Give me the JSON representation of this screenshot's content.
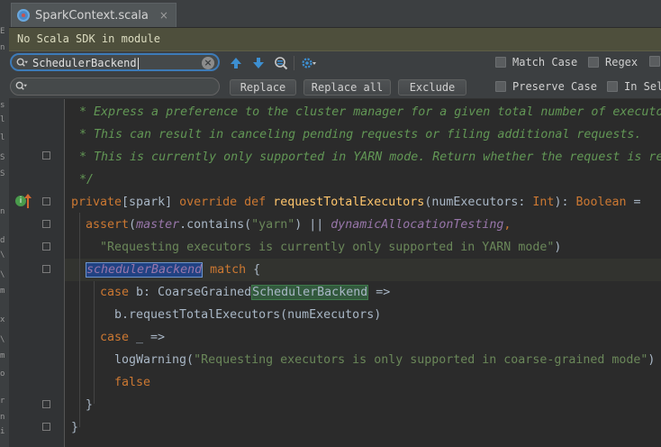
{
  "tab": {
    "title": "SparkContext.scala",
    "close": "×",
    "icon": "scala-file-icon"
  },
  "banner": {
    "text": "No Scala SDK in module"
  },
  "find": {
    "search_value": "SchedulerBackend",
    "replace_value": "",
    "buttons": {
      "replace": "Replace",
      "replace_all": "Replace all",
      "exclude": "Exclude"
    },
    "options": {
      "match_case": "Match Case",
      "regex": "Regex",
      "preserve_case": "Preserve Case",
      "in_selection": "In Sel"
    }
  },
  "code": {
    "line1": " * Express a preference to the cluster manager for a given total number of executo",
    "line2": " * This can result in canceling pending requests or filing additional requests.",
    "line3": " * This is currently only supported in YARN mode. Return whether the request is re",
    "line4": " */",
    "l5_private": "private",
    "l5_spark": "[spark] ",
    "l5_override": "override",
    "l5_def": "def",
    "l5_name": "requestTotalExecutors",
    "l5_param": "(numExecutors: ",
    "l5_int": "Int",
    "l5_close": "): ",
    "l5_bool": "Boolean",
    "l5_eq": " =",
    "l6_assert": "assert",
    "l6_open": "(",
    "l6_master": "master",
    "l6_contains": ".contains(",
    "l6_yarn": "\"yarn\"",
    "l6_or": ") || ",
    "l6_dyn": "dynamicAllocationTesting",
    "l6_comma": ",",
    "l7_str": "\"Requesting executors is currently only supported in YARN mode\"",
    "l7_close": ")",
    "l8_sched": "schedulerBackend",
    "l8_match": "match",
    "l8_brace": " {",
    "l9_case": "case",
    "l9_b": " b: CoarseGrained",
    "l9_hit": "SchedulerBackend",
    "l9_arrow": " =>",
    "l10": "b.requestTotalExecutors(numExecutors)",
    "l11_case": "case",
    "l11_rest": " _ =>",
    "l12_log": "logWarning(",
    "l12_str": "\"Requesting executors is only supported in coarse-grained mode\"",
    "l12_close": ")",
    "l13_false": "false",
    "l14": "}",
    "l15": "}"
  },
  "left_strip": [
    "E",
    "n",
    "s",
    "l",
    "l",
    "S",
    "S",
    "n",
    "d",
    "\\",
    "\\",
    "m",
    "x",
    "\\",
    "m",
    "o",
    "r",
    "n",
    "i"
  ]
}
